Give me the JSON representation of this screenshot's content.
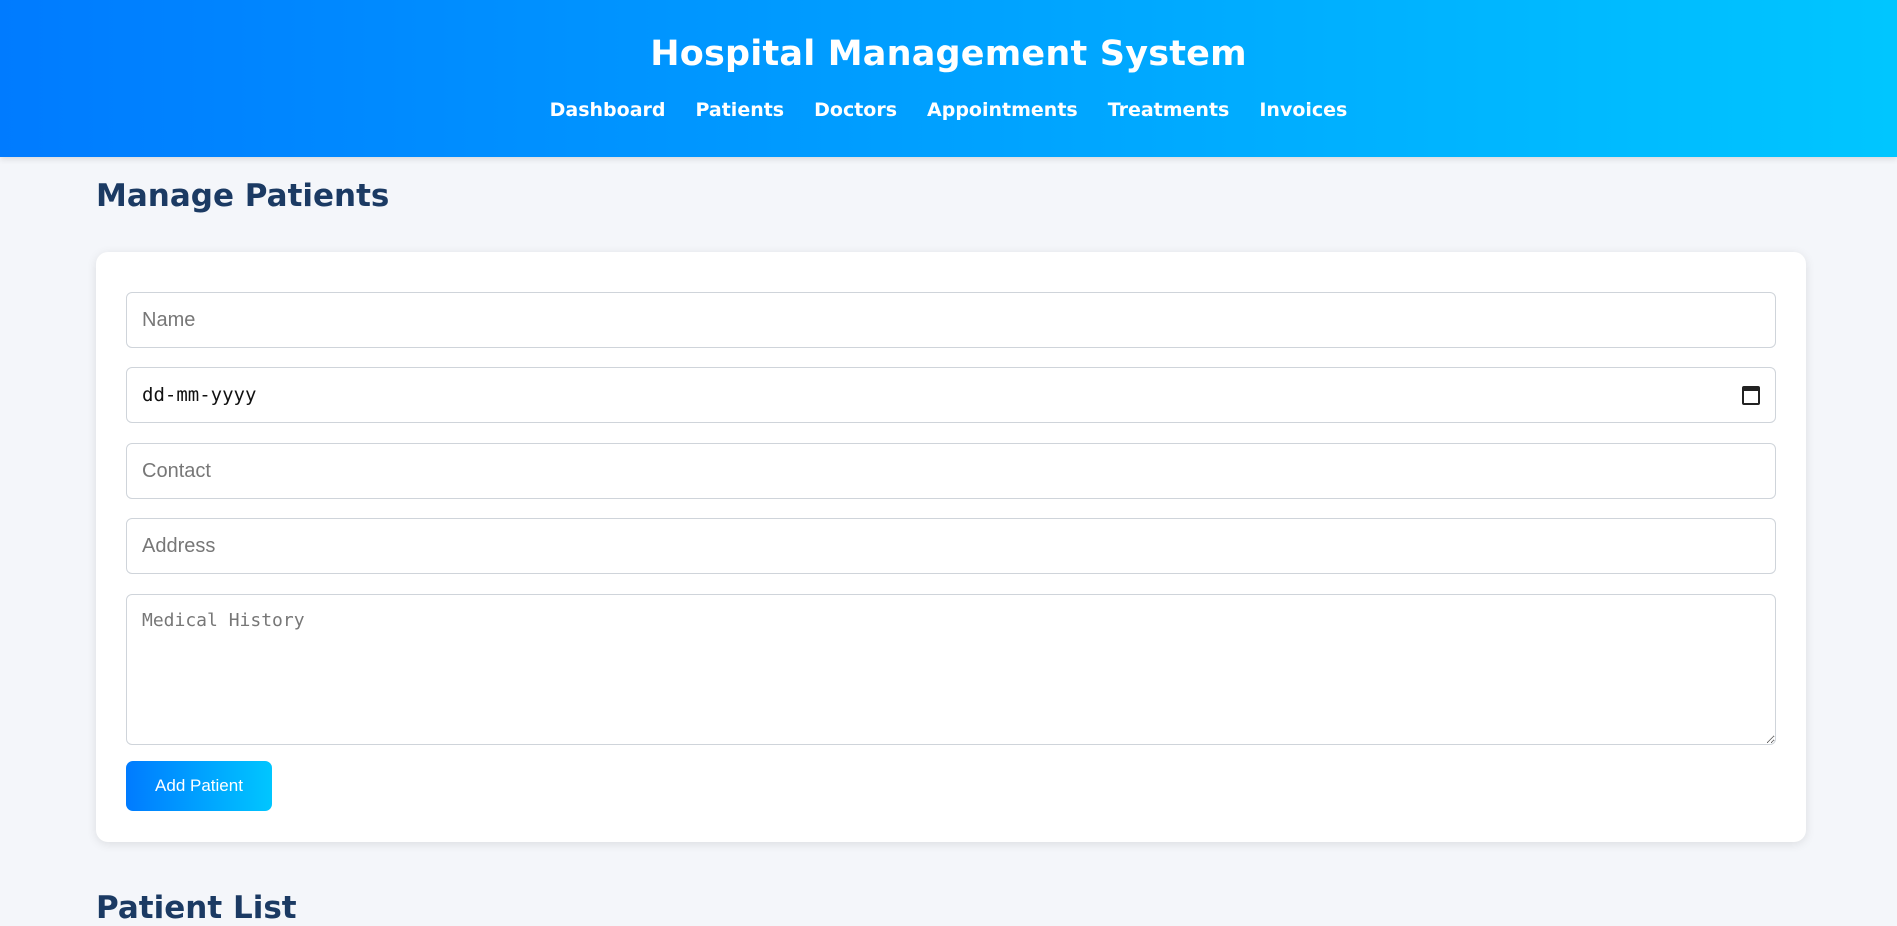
{
  "header": {
    "title": "Hospital Management System",
    "nav": [
      "Dashboard",
      "Patients",
      "Doctors",
      "Appointments",
      "Treatments",
      "Invoices"
    ]
  },
  "main": {
    "section_title": "Manage Patients",
    "form": {
      "name_placeholder": "Name",
      "dob_value": "dd-mm-yyyy",
      "contact_placeholder": "Contact",
      "address_placeholder": "Address",
      "history_placeholder": "Medical History",
      "submit_label": "Add Patient"
    },
    "list_title": "Patient List"
  },
  "colors": {
    "header_gradient_start": "#007bff",
    "header_gradient_end": "#00c6ff",
    "heading": "#1b3a63",
    "background": "#f4f6fa"
  },
  "icons": {
    "date_picker": "calendar-icon",
    "textarea_resize": "resize-handle-icon"
  }
}
